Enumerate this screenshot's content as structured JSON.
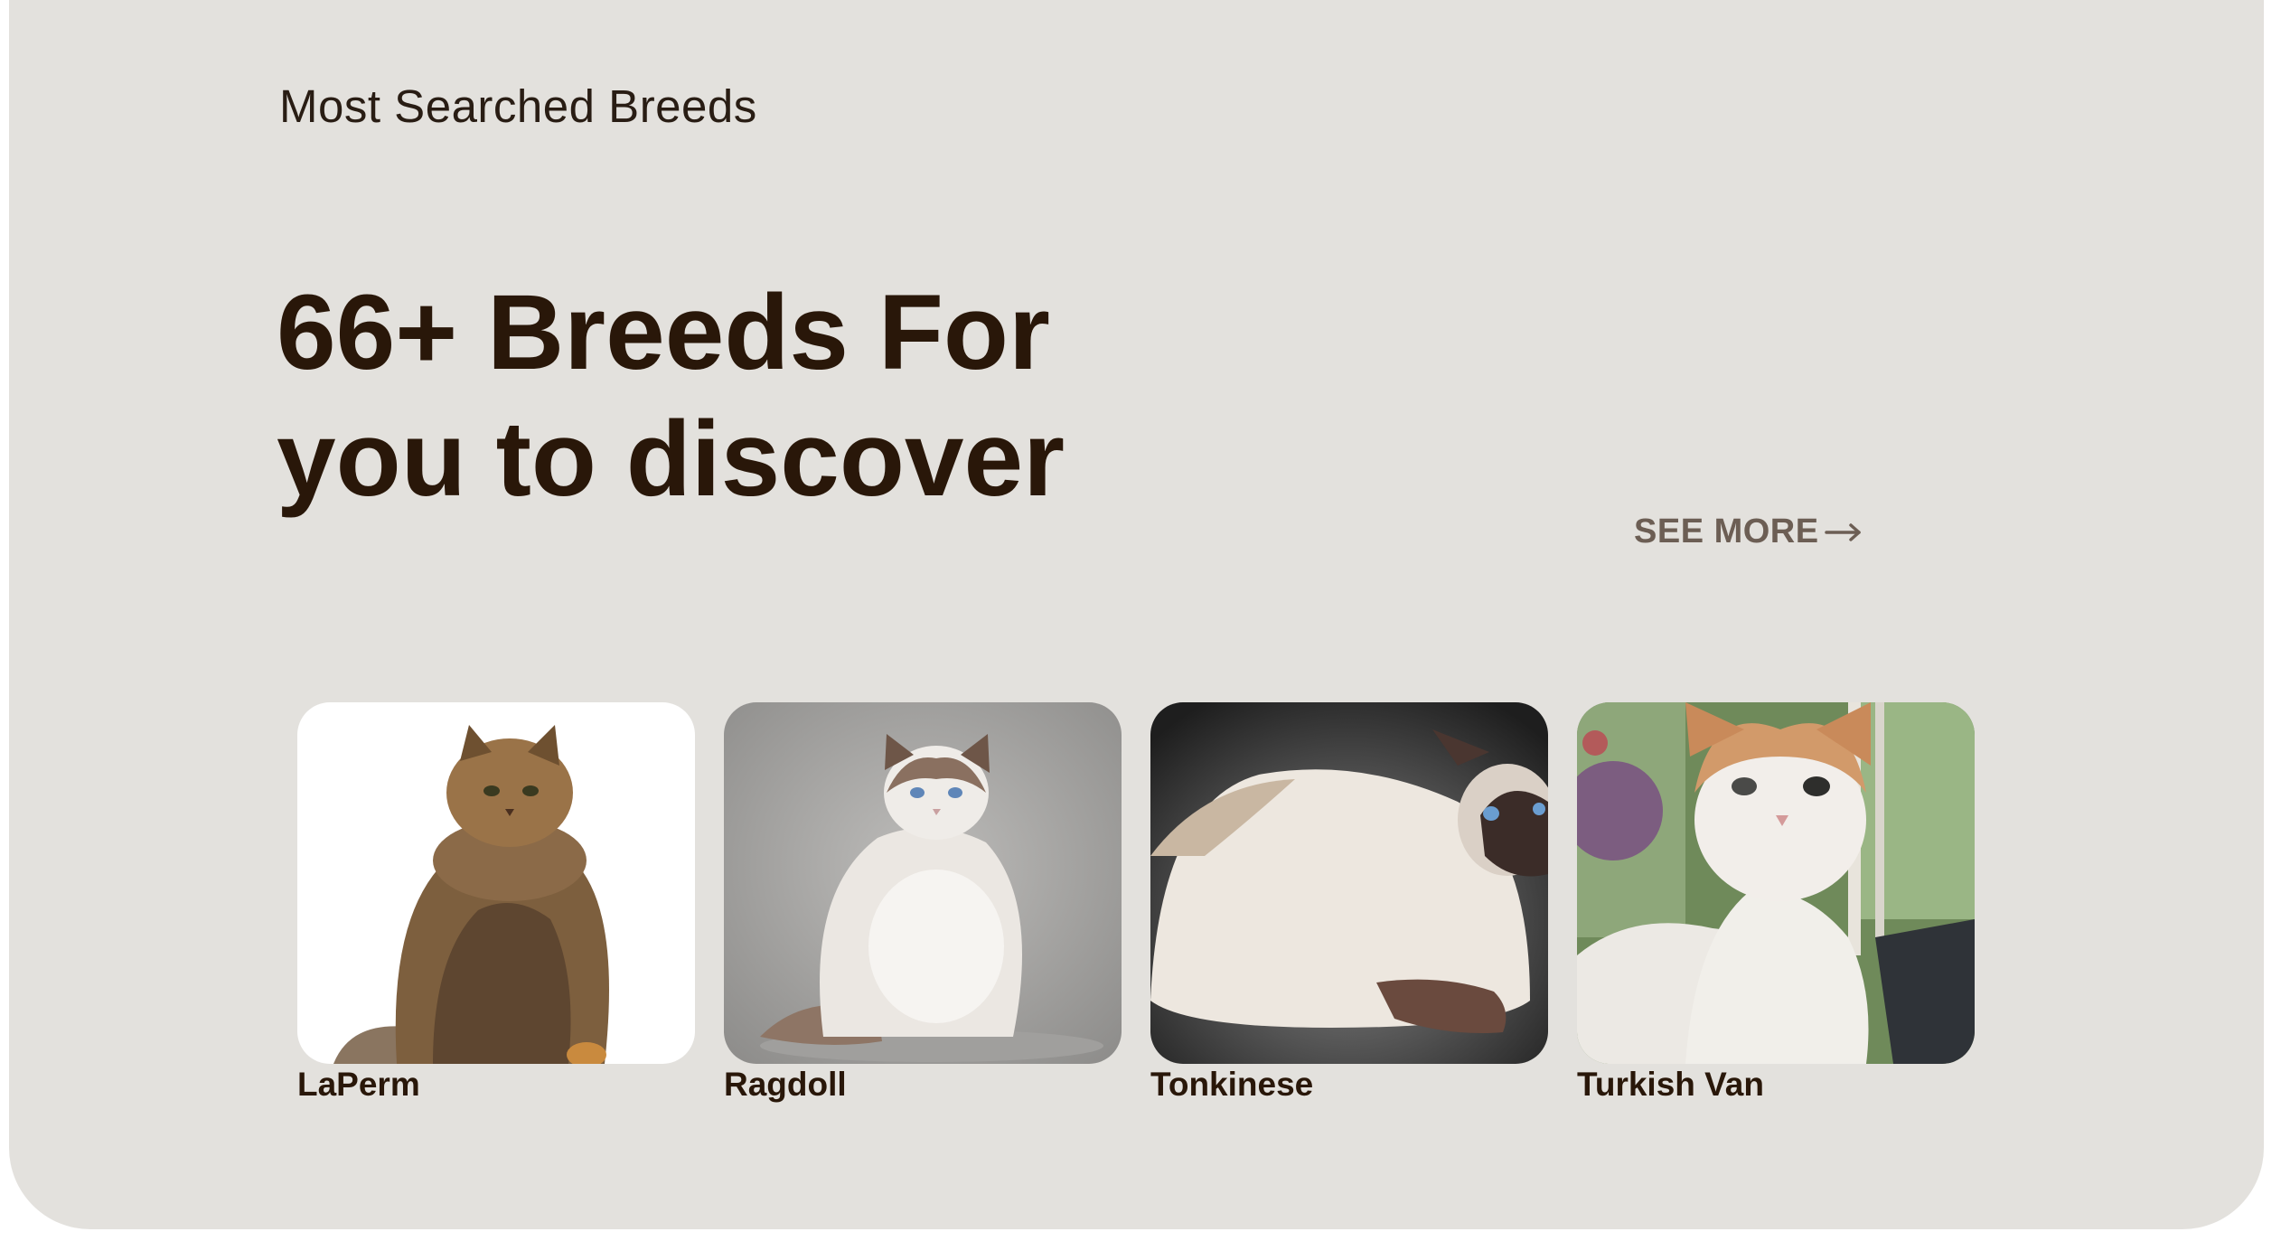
{
  "section": {
    "eyebrow": "Most Searched Breeds",
    "headline_line1": "66+ Breeds For",
    "headline_line2": "you to discover",
    "see_more_label": "SEE MORE"
  },
  "breeds": [
    {
      "name": "LaPerm",
      "photo_background": "#ffffff"
    },
    {
      "name": "Ragdoll",
      "photo_background": "#a8a7a5"
    },
    {
      "name": "Tonkinese",
      "photo_background": "#2f2f2f"
    },
    {
      "name": "Turkish Van",
      "photo_background": "#7a8f6a"
    }
  ],
  "colors": {
    "panel": "#e3e1dd",
    "heading": "#291709",
    "link": "#6c5e54"
  }
}
